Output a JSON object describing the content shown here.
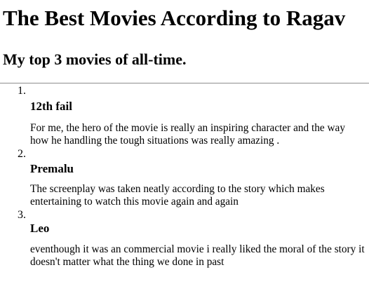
{
  "header": {
    "title": "The Best Movies According to Ragav",
    "subtitle": "My top 3 movies of all-time."
  },
  "movies": [
    {
      "number": "1.",
      "title": "12th fail",
      "review": "For me, the hero of the movie is really an inspiring character and the way how he handling the tough situations was really amazing ."
    },
    {
      "number": "2.",
      "title": "Premalu",
      "review": "The screenplay was taken neatly according to the story which makes entertaining to watch this movie again and again"
    },
    {
      "number": "3.",
      "title": "Leo",
      "review": "eventhough it was an commercial movie i really liked the moral of the story it doesn't matter what the thing we done in past"
    }
  ]
}
